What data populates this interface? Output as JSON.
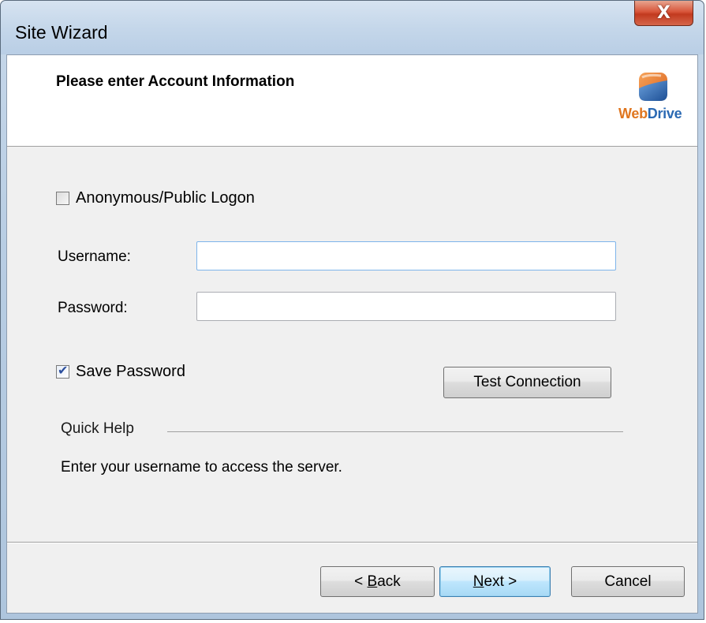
{
  "window": {
    "title": "Site Wizard",
    "close_glyph": "X"
  },
  "header": {
    "title": "Please enter Account Information",
    "logo": {
      "text_web": "Web",
      "text_drive": "Drive"
    }
  },
  "form": {
    "anonymous_label": "Anonymous/Public Logon",
    "anonymous_checked": false,
    "username_label": "Username:",
    "username_value": "",
    "password_label": "Password:",
    "password_value": "",
    "save_password_label": "Save Password",
    "save_password_checked": true,
    "test_connection_label": "Test Connection"
  },
  "quick_help": {
    "heading": "Quick Help",
    "text": "Enter your username to access the server."
  },
  "buttons": {
    "back_prefix": "< ",
    "back_mnemonic": "B",
    "back_rest": "ack",
    "next_mnemonic": "N",
    "next_rest": "ext >",
    "cancel": "Cancel"
  },
  "colors": {
    "logo_orange": "#e0761f",
    "logo_blue": "#2a69b3",
    "close_red": "#c23a1f"
  }
}
